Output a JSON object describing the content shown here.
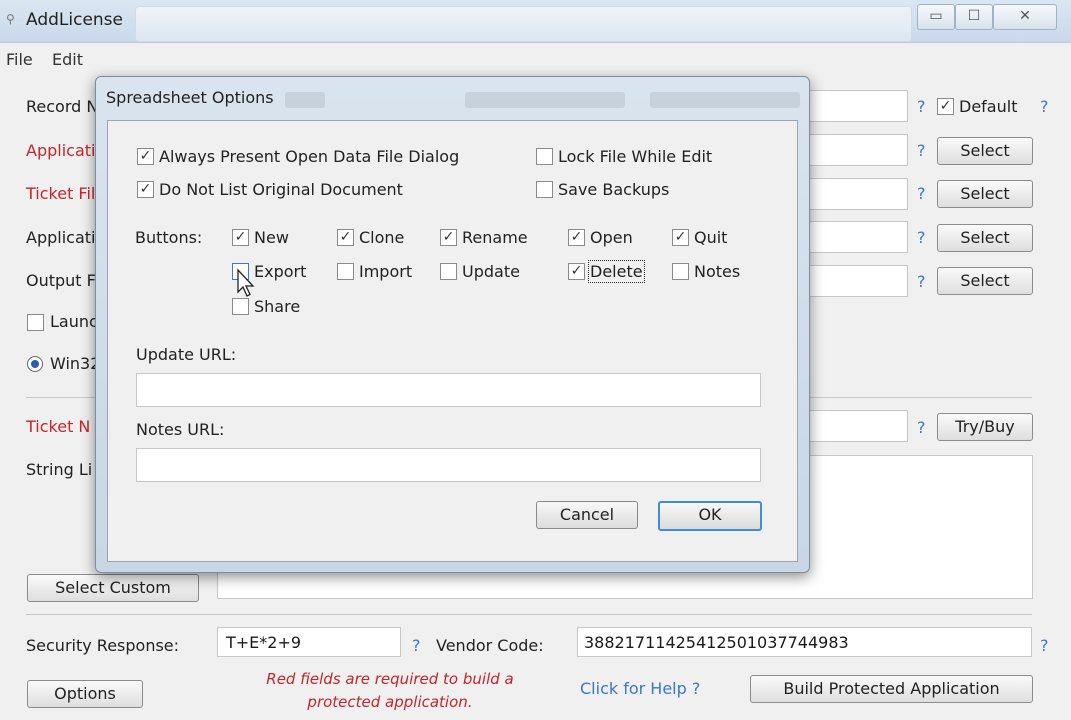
{
  "window": {
    "title": "AddLicense",
    "app_icon": "license-icon",
    "minimize_glyph": "▭",
    "maximize_glyph": "☐",
    "close_glyph": "✕"
  },
  "menu": [
    "File",
    "Edit"
  ],
  "main": {
    "record_label": "Record N",
    "default_label": "Default",
    "default_checked": true,
    "application_label": "Applicati",
    "ticket_file_label": "Ticket Fil",
    "application2_label": "Applicati",
    "output_label": "Output F",
    "launch_label": "Launc",
    "win32_label": "Win32",
    "ticket_number_label": "Ticket N",
    "string_list_label": "String Li",
    "select_label": "Select",
    "try_buy_label": "Try/Buy",
    "question_mark": "?",
    "select_custom_label": "Select Custom",
    "security_response_label": "Security Response:",
    "security_response_value": "T+E*2+9",
    "vendor_code_label": "Vendor Code:",
    "vendor_code_value": "38821711425412501037744983",
    "options_label": "Options",
    "required_note_line1": "Red fields are required to build a",
    "required_note_line2": "protected application.",
    "help_link": "Click for Help ?",
    "build_label": "Build Protected Application"
  },
  "dialog": {
    "title": "Spreadsheet Options",
    "options": [
      {
        "label": "Always Present Open Data File Dialog",
        "checked": true
      },
      {
        "label": "Do Not List Original Document",
        "checked": true
      },
      {
        "label": "Lock File While Edit",
        "checked": false
      },
      {
        "label": "Save Backups",
        "checked": false
      }
    ],
    "buttons_label": "Buttons:",
    "button_options": [
      {
        "label": "New",
        "checked": true
      },
      {
        "label": "Clone",
        "checked": true
      },
      {
        "label": "Rename",
        "checked": true
      },
      {
        "label": "Open",
        "checked": true
      },
      {
        "label": "Quit",
        "checked": true
      },
      {
        "label": "Export",
        "checked": false
      },
      {
        "label": "Import",
        "checked": false
      },
      {
        "label": "Update",
        "checked": false
      },
      {
        "label": "Delete",
        "checked": true
      },
      {
        "label": "Notes",
        "checked": false
      },
      {
        "label": "Share",
        "checked": false
      }
    ],
    "update_url_label": "Update URL:",
    "update_url_value": "",
    "notes_url_label": "Notes URL:",
    "notes_url_value": "",
    "cancel_label": "Cancel",
    "ok_label": "OK"
  }
}
